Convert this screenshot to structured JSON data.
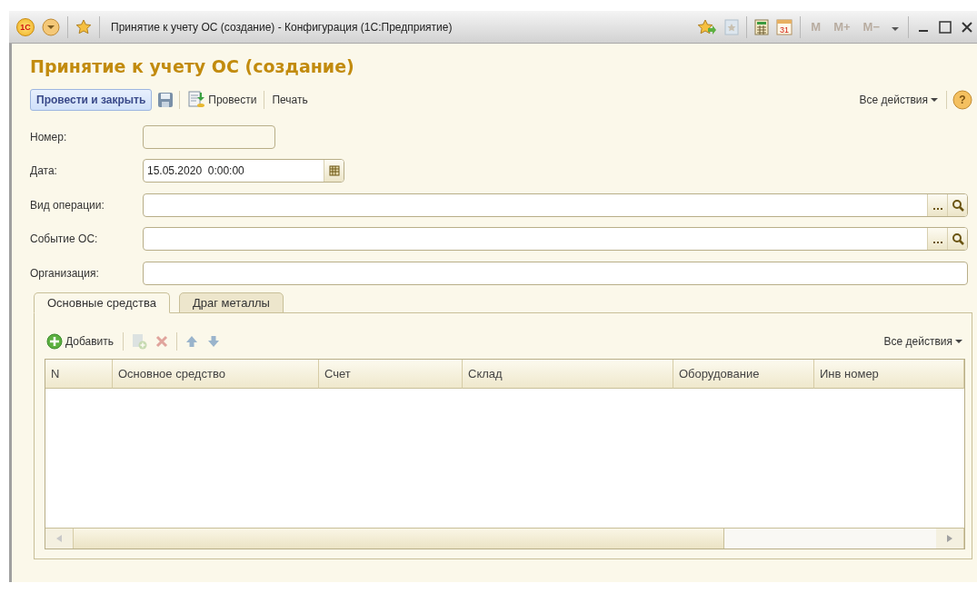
{
  "window": {
    "logo": "1С",
    "title": "Принятие к учету ОС (создание) - Конфигурация  (1С:Предприятие)",
    "calendar_day": "31",
    "memory_buttons": [
      {
        "label": "M",
        "disabled": true
      },
      {
        "label": "M+",
        "disabled": true
      },
      {
        "label": "M−",
        "disabled": true
      }
    ]
  },
  "form_title": "Принятие к учету ОС (создание)",
  "toolbar": {
    "primary": "Провести и закрыть",
    "post": "Провести",
    "print": "Печать",
    "all_actions": "Все действия",
    "help": "?"
  },
  "fields": [
    {
      "label": "Номер:",
      "kind": "short",
      "disabled": true
    },
    {
      "label": "Дата:",
      "kind": "date",
      "value": "15.05.2020  0:00:00",
      "disabled": false
    },
    {
      "label": "Вид операции:",
      "kind": "choice",
      "disabled": false
    },
    {
      "label": "Событие ОС:",
      "kind": "choice",
      "disabled": false
    },
    {
      "label": "Организация:",
      "kind": "plain",
      "disabled": false
    }
  ],
  "tabs": [
    {
      "label": "Основные средства",
      "selected": true
    },
    {
      "label": "Драг металлы",
      "selected": false
    }
  ],
  "table_toolbar": {
    "add": "Добавить",
    "copy_disabled": true,
    "delete_disabled": true,
    "all_actions": "Все действия"
  },
  "table": {
    "columns": [
      "N",
      "Основное средство",
      "Счет",
      "Склад",
      "Оборудование",
      "Инв номер"
    ]
  }
}
